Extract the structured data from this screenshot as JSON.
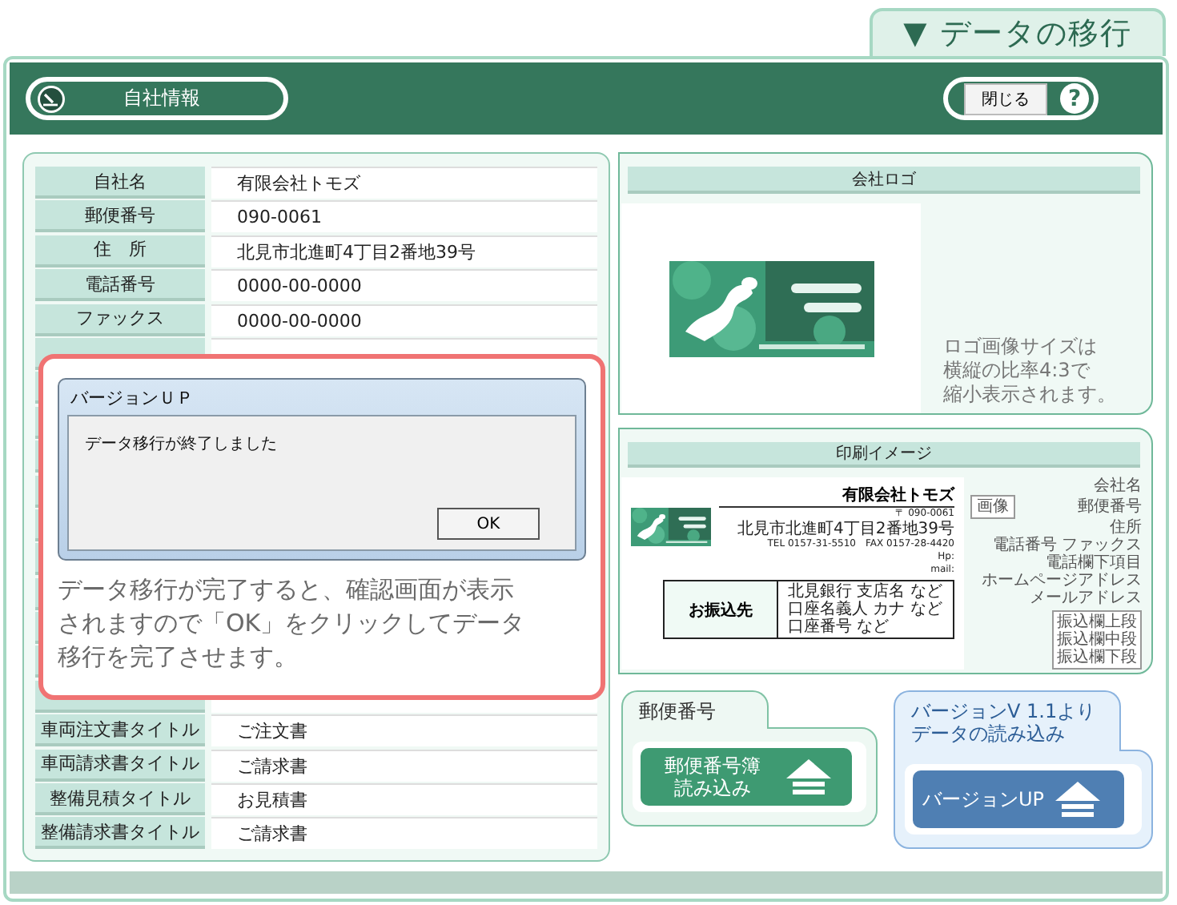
{
  "section_tab": {
    "label": "▼ データの移行"
  },
  "header": {
    "company_button": "自社情報",
    "close_button": "閉じる",
    "help_button": "?"
  },
  "company_fields_top": [
    {
      "label": "自社名",
      "value": "有限会社トモズ"
    },
    {
      "label": "郵便番号",
      "value": "090-0061"
    },
    {
      "label": "住　所",
      "value": "北見市北進町4丁目2番地39号"
    },
    {
      "label": "電話番号",
      "value": "0000-00-0000"
    },
    {
      "label": "ファックス",
      "value": "0000-00-0000"
    }
  ],
  "company_fields_bottom": [
    {
      "label": "車両注文書タイトル",
      "value": "ご注文書"
    },
    {
      "label": "車両請求書タイトル",
      "value": "ご請求書"
    },
    {
      "label": "整備見積タイトル",
      "value": "お見積書"
    },
    {
      "label": "整備請求書タイトル",
      "value": "ご請求書"
    }
  ],
  "dialog": {
    "title": "バージョンＵＰ",
    "message": "データ移行が終了しました",
    "ok_button": "OK"
  },
  "callout_text": "データ移行が完了すると、確認画面が表示されますので「OK」をクリックしてデータ移行を完了させます。",
  "logo_panel": {
    "title": "会社ロゴ",
    "logo": {
      "kind": "picture"
    },
    "note_lines": [
      "ロゴ画像サイズは",
      "横縦の比率4:3で",
      "縮小表示されます。"
    ]
  },
  "print_preview": {
    "title": "印刷イメージ",
    "company": "有限会社トモズ",
    "postal": "〒 090-0061",
    "address": "北見市北進町4丁目2番地39号",
    "phone_fax": "TEL 0157-31-5510　FAX 0157-28-4420",
    "hp": "Hp:",
    "mail": "mail:",
    "transfer_heading": "お振込先",
    "transfer_lines": [
      "北見銀行 支店名 など",
      "口座名義人 カナ など",
      "口座番号 など"
    ],
    "legend_company": "会社名",
    "legend_image": "画像",
    "legend_postal": "郵便番号",
    "legend_lines": [
      "住所",
      "電話番号 ファックス",
      "電話欄下項目",
      "ホームページアドレス",
      "メールアドレス"
    ],
    "legend_transfer": [
      "振込欄上段",
      "振込欄中段",
      "振込欄下段"
    ]
  },
  "postal_panel": {
    "tab": "郵便番号",
    "button": "郵便番号簿読み込み"
  },
  "version_panel": {
    "tab": "バージョンV 1.1よりデータの読み込み",
    "button": "バージョンUP"
  }
}
